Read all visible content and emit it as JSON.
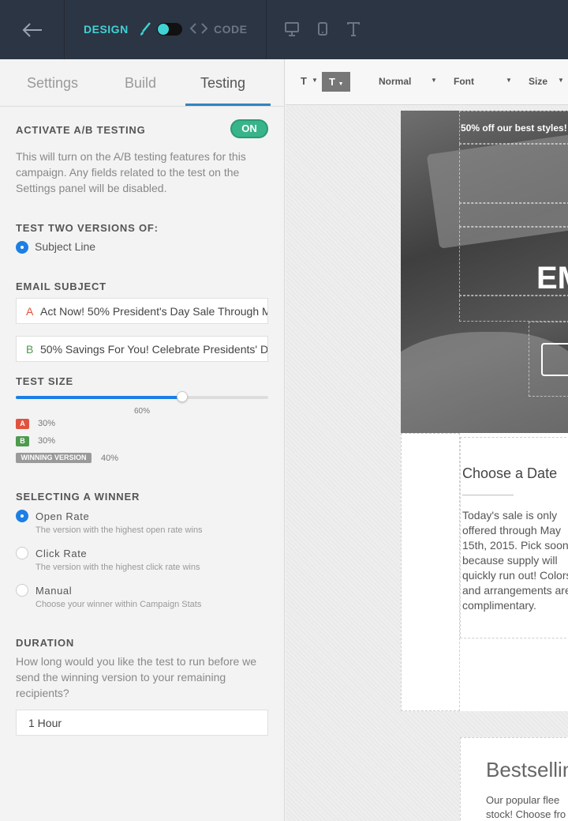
{
  "topbar": {
    "design_label": "DESIGN",
    "code_label": "CODE",
    "icons": [
      "back-arrow-icon",
      "brush-icon",
      "code-icon",
      "desktop-icon",
      "mobile-icon",
      "text-icon"
    ],
    "accent": "#3fd3d6"
  },
  "tabs": [
    {
      "label": "Settings"
    },
    {
      "label": "Build"
    },
    {
      "label": "Testing"
    }
  ],
  "ab": {
    "title": "ACTIVATE A/B TESTING",
    "toggle": "ON",
    "description": "This will turn on the A/B testing features for this campaign. Any fields related to the test on the Settings panel will be disabled."
  },
  "versions": {
    "title": "TEST TWO VERSIONS OF:",
    "option": "Subject Line"
  },
  "subject": {
    "title": "EMAIL SUBJECT",
    "a_letter": "A",
    "a_value": "Act Now! 50% President's Day Sale Through Mo",
    "b_letter": "B",
    "b_value": "50% Savings For You! Celebrate Presidents' Da"
  },
  "test_size": {
    "title": "TEST SIZE",
    "value_label": "60%",
    "value_fraction": 0.66,
    "a_badge": "A",
    "a_pct": "30%",
    "b_badge": "B",
    "b_pct": "30%",
    "winner_badge": "WINNING VERSION",
    "winner_pct": "40%"
  },
  "winner": {
    "title": "SELECTING A WINNER",
    "options": [
      {
        "label": "Open Rate",
        "desc": "The version with the highest open rate wins"
      },
      {
        "label": "Click Rate",
        "desc": "The version with the highest click rate wins"
      },
      {
        "label": "Manual",
        "desc": "Choose your winner within Campaign Stats"
      }
    ]
  },
  "duration": {
    "title": "DURATION",
    "description": "How long would you like the test to run before we send the winning version to your remaining recipients?",
    "value": "1 Hour"
  },
  "toolbar": {
    "t1": "T",
    "t2": "T",
    "style": "Normal",
    "font": "Font",
    "size": "Size"
  },
  "preview": {
    "hero_text": "50% off our best styles!",
    "hero_heading": "EM",
    "block1_heading": "Choose a Date",
    "block1_text": "Today's sale is only\noffered through May\n15th, 2015. Pick soon\nbecause supply will\nquickly run out! Colors\nand arrangements are\ncomplimentary.",
    "block2_heading": "Bestsellin",
    "block2_text": "Our popular flee\nstock! Choose fro"
  },
  "colors": {
    "primary_blue": "#1c7fe6",
    "on_green": "#38b48b",
    "badge_a": "#e0533f",
    "badge_b": "#4e9a4e",
    "badge_winner": "#9a9a9a"
  }
}
